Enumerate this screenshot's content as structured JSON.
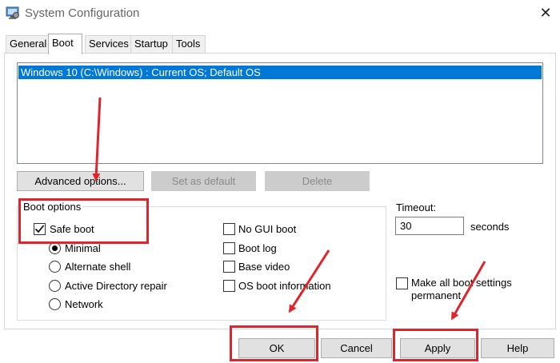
{
  "window": {
    "title": "System Configuration",
    "app_icon": "system-config-icon",
    "close_glyph": "✕"
  },
  "tabs": [
    {
      "label": "General",
      "active": false
    },
    {
      "label": "Boot",
      "active": true
    },
    {
      "label": "Services",
      "active": false
    },
    {
      "label": "Startup",
      "active": false
    },
    {
      "label": "Tools",
      "active": false
    }
  ],
  "os_list": {
    "items": [
      "Windows 10 (C:\\Windows) : Current OS; Default OS"
    ]
  },
  "buttons": {
    "advanced": "Advanced options...",
    "set_default": "Set as default",
    "delete": "Delete",
    "ok": "OK",
    "cancel": "Cancel",
    "apply": "Apply",
    "help": "Help"
  },
  "boot_options": {
    "label": "Boot options",
    "safe_boot": {
      "label": "Safe boot",
      "checked": true
    },
    "radios": [
      {
        "label": "Minimal",
        "selected": true
      },
      {
        "label": "Alternate shell",
        "selected": false
      },
      {
        "label": "Active Directory repair",
        "selected": false
      },
      {
        "label": "Network",
        "selected": false
      }
    ],
    "checks": [
      {
        "label": "No GUI boot",
        "checked": false
      },
      {
        "label": "Boot log",
        "checked": false
      },
      {
        "label": "Base video",
        "checked": false
      },
      {
        "label": "OS boot information",
        "checked": false
      }
    ]
  },
  "timeout": {
    "label": "Timeout:",
    "value": "30",
    "unit": "seconds"
  },
  "permanent": {
    "line1": "Make all boot settings",
    "line2": "permanent",
    "checked": false
  },
  "colors": {
    "selection": "#0078d7",
    "annotation": "#e0242b"
  }
}
